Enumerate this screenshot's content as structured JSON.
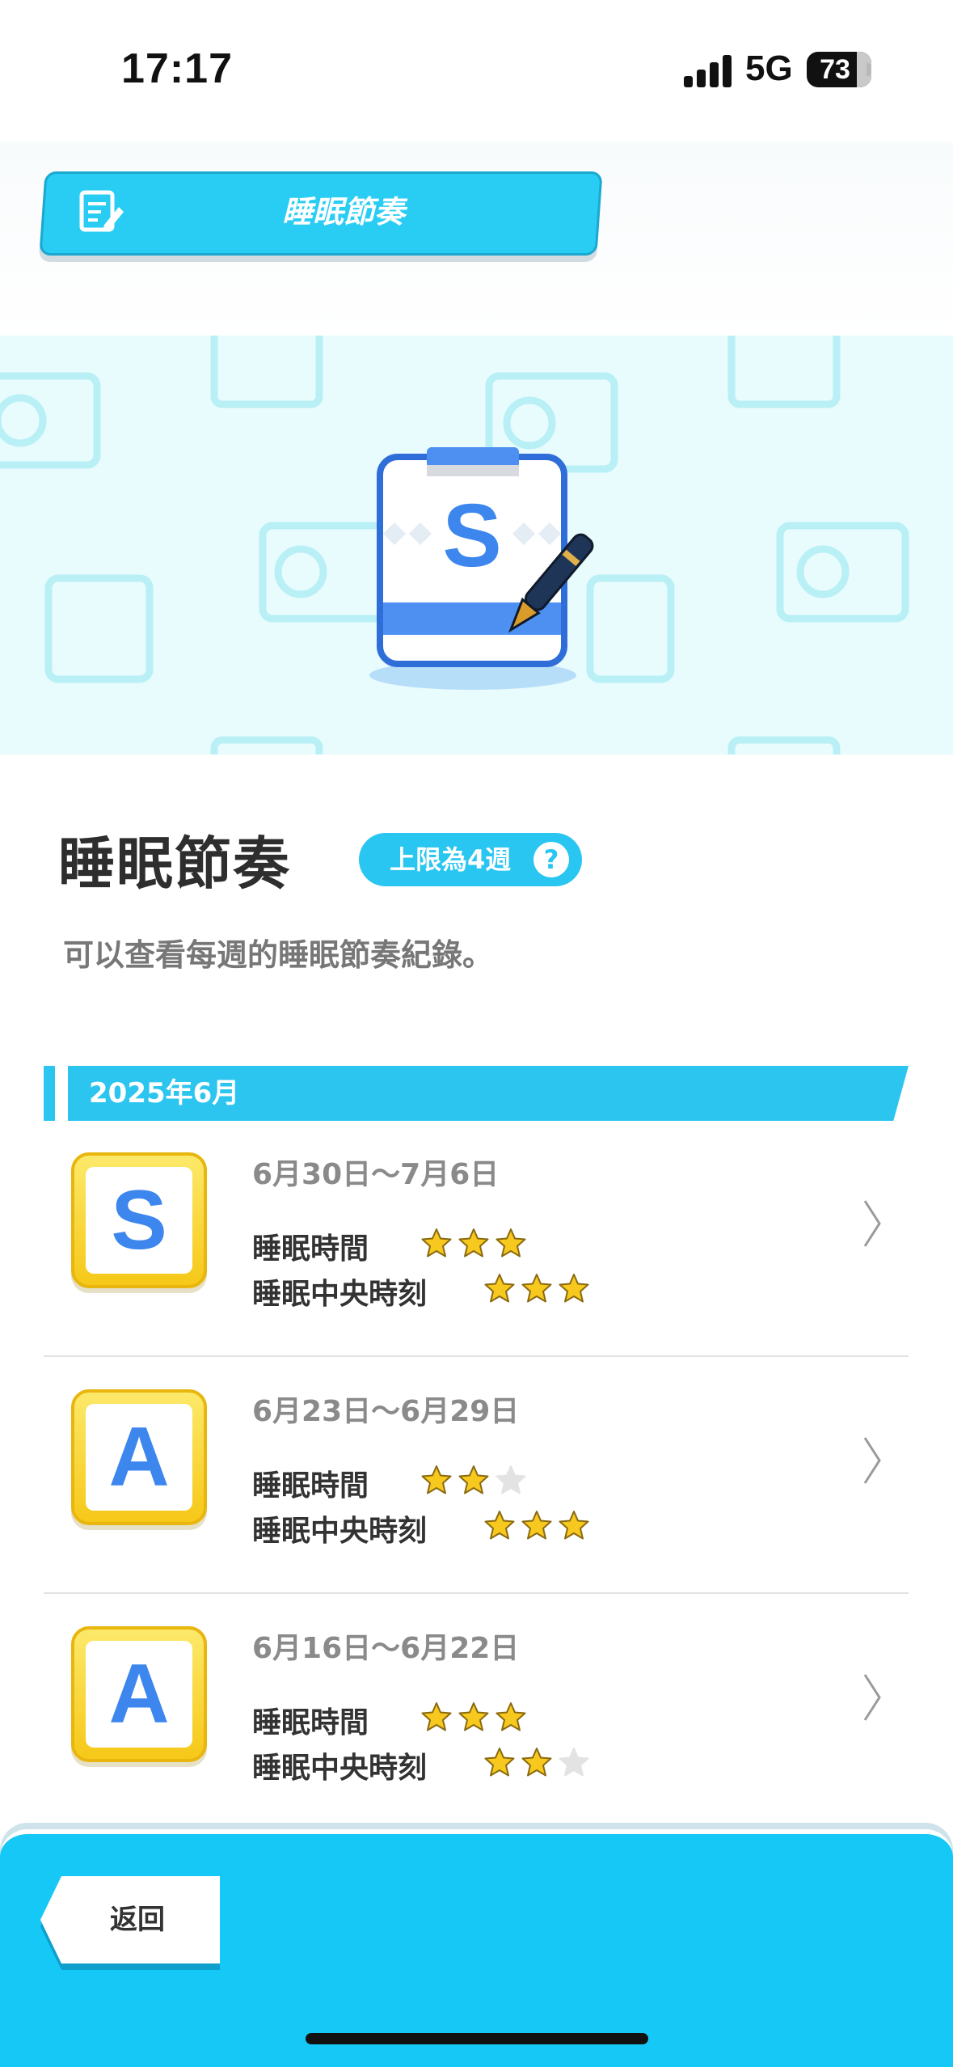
{
  "status_bar": {
    "time": "17:17",
    "network": "5G",
    "battery": "73"
  },
  "header": {
    "title": "睡眠節奏",
    "icon": "notepad-pencil-icon"
  },
  "hero": {
    "grade": "S",
    "icon": "clipboard-pen-icon"
  },
  "section": {
    "title": "睡眠節奏",
    "limit_badge": "上限為4週",
    "help": "?",
    "description": "可以查看每週的睡眠節奏紀錄。"
  },
  "month": "2025年6月",
  "weeks": [
    {
      "grade": "S",
      "range": "6月30日〜7月6日",
      "sleep_time_label": "睡眠時間",
      "sleep_time_stars": 3,
      "mid_sleep_label": "睡眠中央時刻",
      "mid_sleep_stars": 3
    },
    {
      "grade": "A",
      "range": "6月23日〜6月29日",
      "sleep_time_label": "睡眠時間",
      "sleep_time_stars": 2,
      "mid_sleep_label": "睡眠中央時刻",
      "mid_sleep_stars": 3
    },
    {
      "grade": "A",
      "range": "6月16日〜6月22日",
      "sleep_time_label": "睡眠時間",
      "sleep_time_stars": 3,
      "mid_sleep_label": "睡眠中央時刻",
      "mid_sleep_stars": 2
    }
  ],
  "stars_max": 3,
  "colors": {
    "accent": "#29cdf4",
    "grade_letter": "#3d86ee",
    "star_on": "#f7c81e",
    "star_off": "#e3e3e3"
  },
  "footer": {
    "back_label": "返回"
  }
}
